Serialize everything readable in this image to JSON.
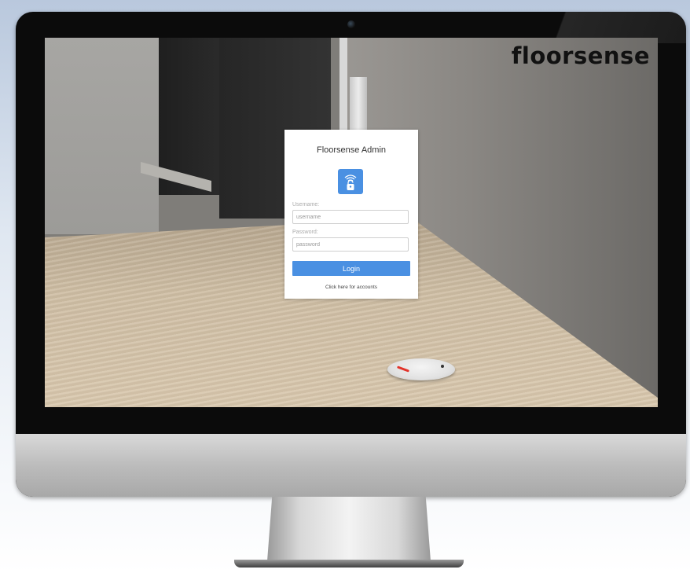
{
  "brand": {
    "wordmark": "floorsense"
  },
  "login": {
    "title": "Floorsense Admin",
    "icon": "wifi-lock-icon",
    "username_label": "Username:",
    "username_placeholder": "username",
    "password_label": "Password:",
    "password_placeholder": "password",
    "login_button": "Login",
    "accounts_link": "Click here for accounts"
  },
  "colors": {
    "accent": "#4a90e2",
    "card_background": "#ffffff",
    "sensor_led": "#e2332a"
  }
}
